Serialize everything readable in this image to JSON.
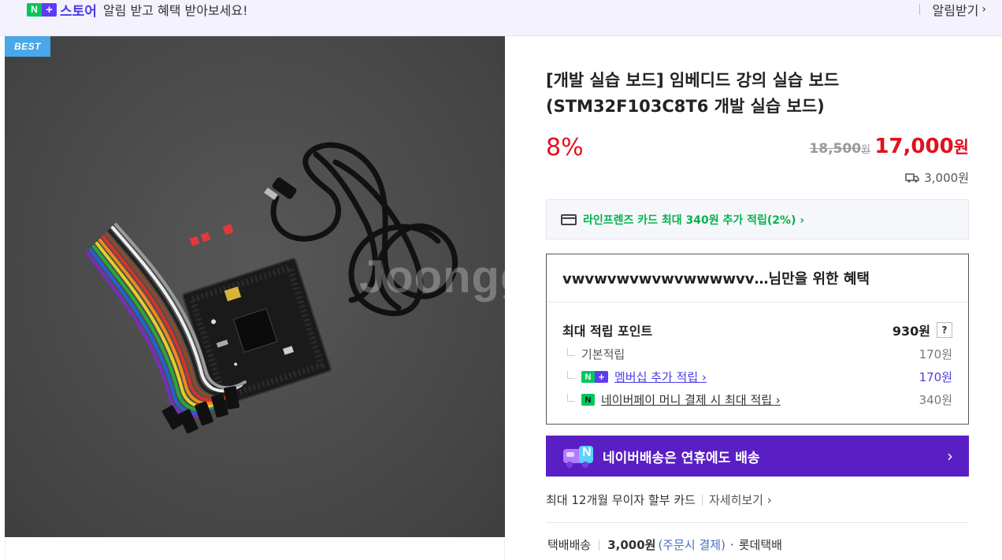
{
  "banner": {
    "logo_n": "N",
    "logo_plus": "+",
    "store_name": "스토어",
    "message": "알림 받고 혜택 받아보세요!",
    "subscribe_label": "알림받기"
  },
  "image": {
    "badge": "BEST",
    "watermark": "Joongg"
  },
  "product": {
    "title": "[개발 실습 보드] 임베디드 강의 실습 보드 (STM32F103C8T6 개발 실습 보드)",
    "discount": "8%",
    "original_price": "18,500",
    "original_unit": "원",
    "sale_price": "17,000",
    "sale_unit": "원",
    "shipping_fee": "3,000원"
  },
  "card_promo": {
    "text": "라인프렌즈 카드 최대 340원 추가 적립(2%) ›"
  },
  "benefits": {
    "header": "vwvwvwvwvwvwwwwvv…님만을 위한 혜택",
    "max_points_label": "최대 적립 포인트",
    "max_points_value": "930원",
    "help": "?",
    "items": [
      {
        "label": "기본적립",
        "value": "170원"
      },
      {
        "label": "멤버십 추가 적립 ›",
        "value": "170원"
      },
      {
        "label": "네이버페이 머니 결제 시 최대 적립 ›",
        "value": "340원"
      }
    ],
    "npay_mark": "N"
  },
  "delivery": {
    "text": "네이버배송은 연휴에도 배송",
    "arrow": "›",
    "icon_letter": "N"
  },
  "installment": {
    "text": "최대 12개월 무이자 할부 카드",
    "link": "자세히보기 ›"
  },
  "shipping": {
    "method": "택배배송",
    "fee": "3,000원",
    "condition": "(주문시 결제)",
    "dot": "·",
    "carrier": "롯데택배"
  }
}
